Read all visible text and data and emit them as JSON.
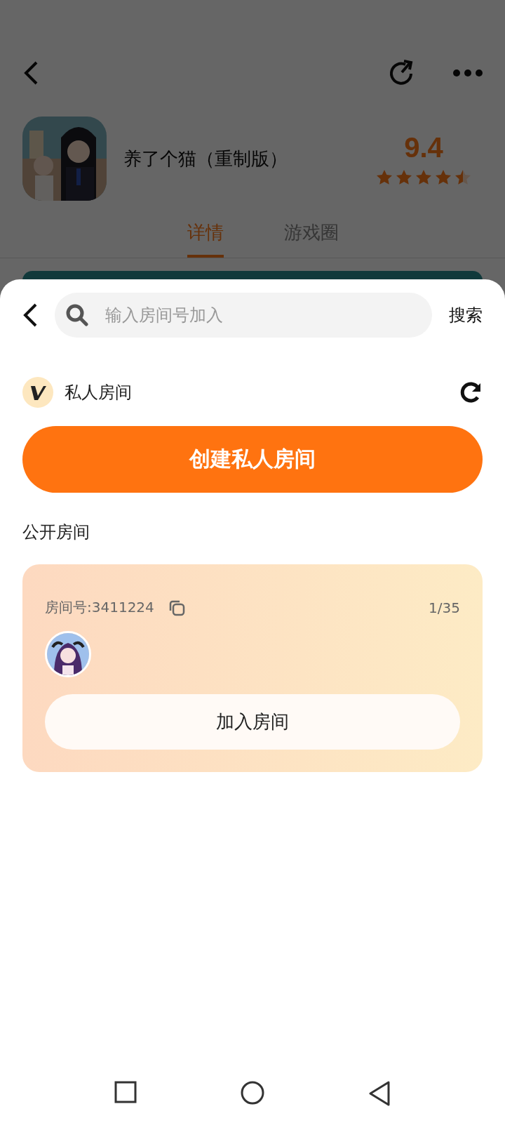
{
  "header": {
    "title": "养了个猫（重制版）",
    "rating": "9.4",
    "stars": 4.5,
    "tabs": [
      {
        "label": "详情",
        "selected": true
      },
      {
        "label": "游戏圈",
        "selected": false
      }
    ]
  },
  "sheet": {
    "search": {
      "placeholder": "输入房间号加入"
    },
    "search_button": "搜索",
    "private": {
      "label": "私人房间",
      "create_button": "创建私人房间"
    },
    "public_title": "公开房间",
    "rooms": [
      {
        "room_no": "房间号:3411224",
        "count": "1/35",
        "join_button": "加入房间"
      }
    ]
  }
}
